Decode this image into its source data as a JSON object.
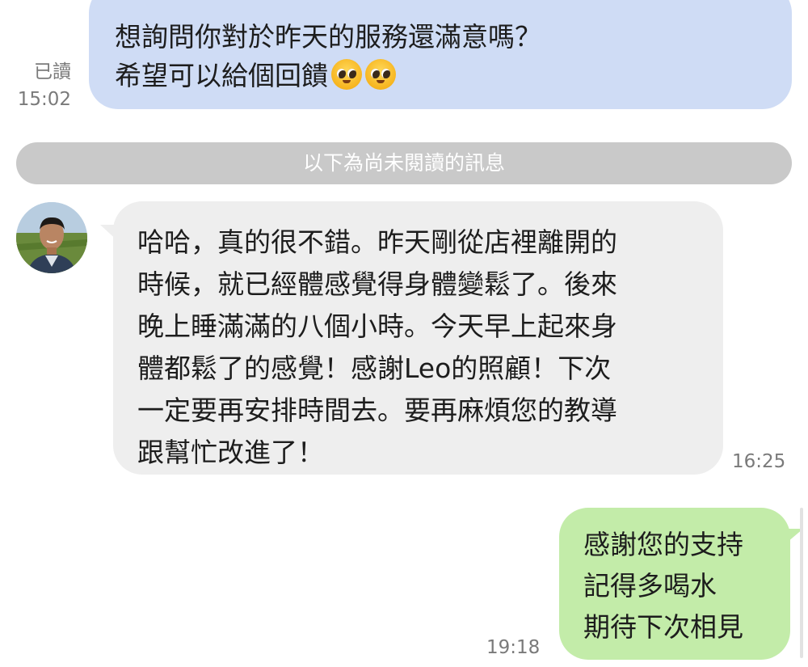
{
  "messages": {
    "outgoing_top": {
      "lines": [
        "想詢問你對於昨天的服務還滿意嗎？",
        "希望可以給個回饋"
      ],
      "emoji": "pleading-face-emoji",
      "read_label": "已讀",
      "time": "15:02",
      "bubble_color": "#cfdcf5"
    },
    "unread_divider": "以下為尚未閱讀的訊息",
    "incoming": {
      "lines": [
        "哈哈，真的很不錯。昨天剛從店裡離開的",
        "時候，就已經體感覺得身體變鬆了。後來",
        "晚上睡滿滿的八個小時。今天早上起來身",
        "體都鬆了的感覺！感謝Leo的照顧！下次",
        "一定要再安排時間去。要再麻煩您的教導",
        "跟幫忙改進了！"
      ],
      "time": "16:25",
      "bubble_color": "#eeeeee"
    },
    "outgoing_bottom": {
      "lines": [
        "感謝您的支持",
        "記得多喝水",
        "期待下次相見"
      ],
      "time": "19:18",
      "bubble_color": "#c3eca9"
    }
  }
}
